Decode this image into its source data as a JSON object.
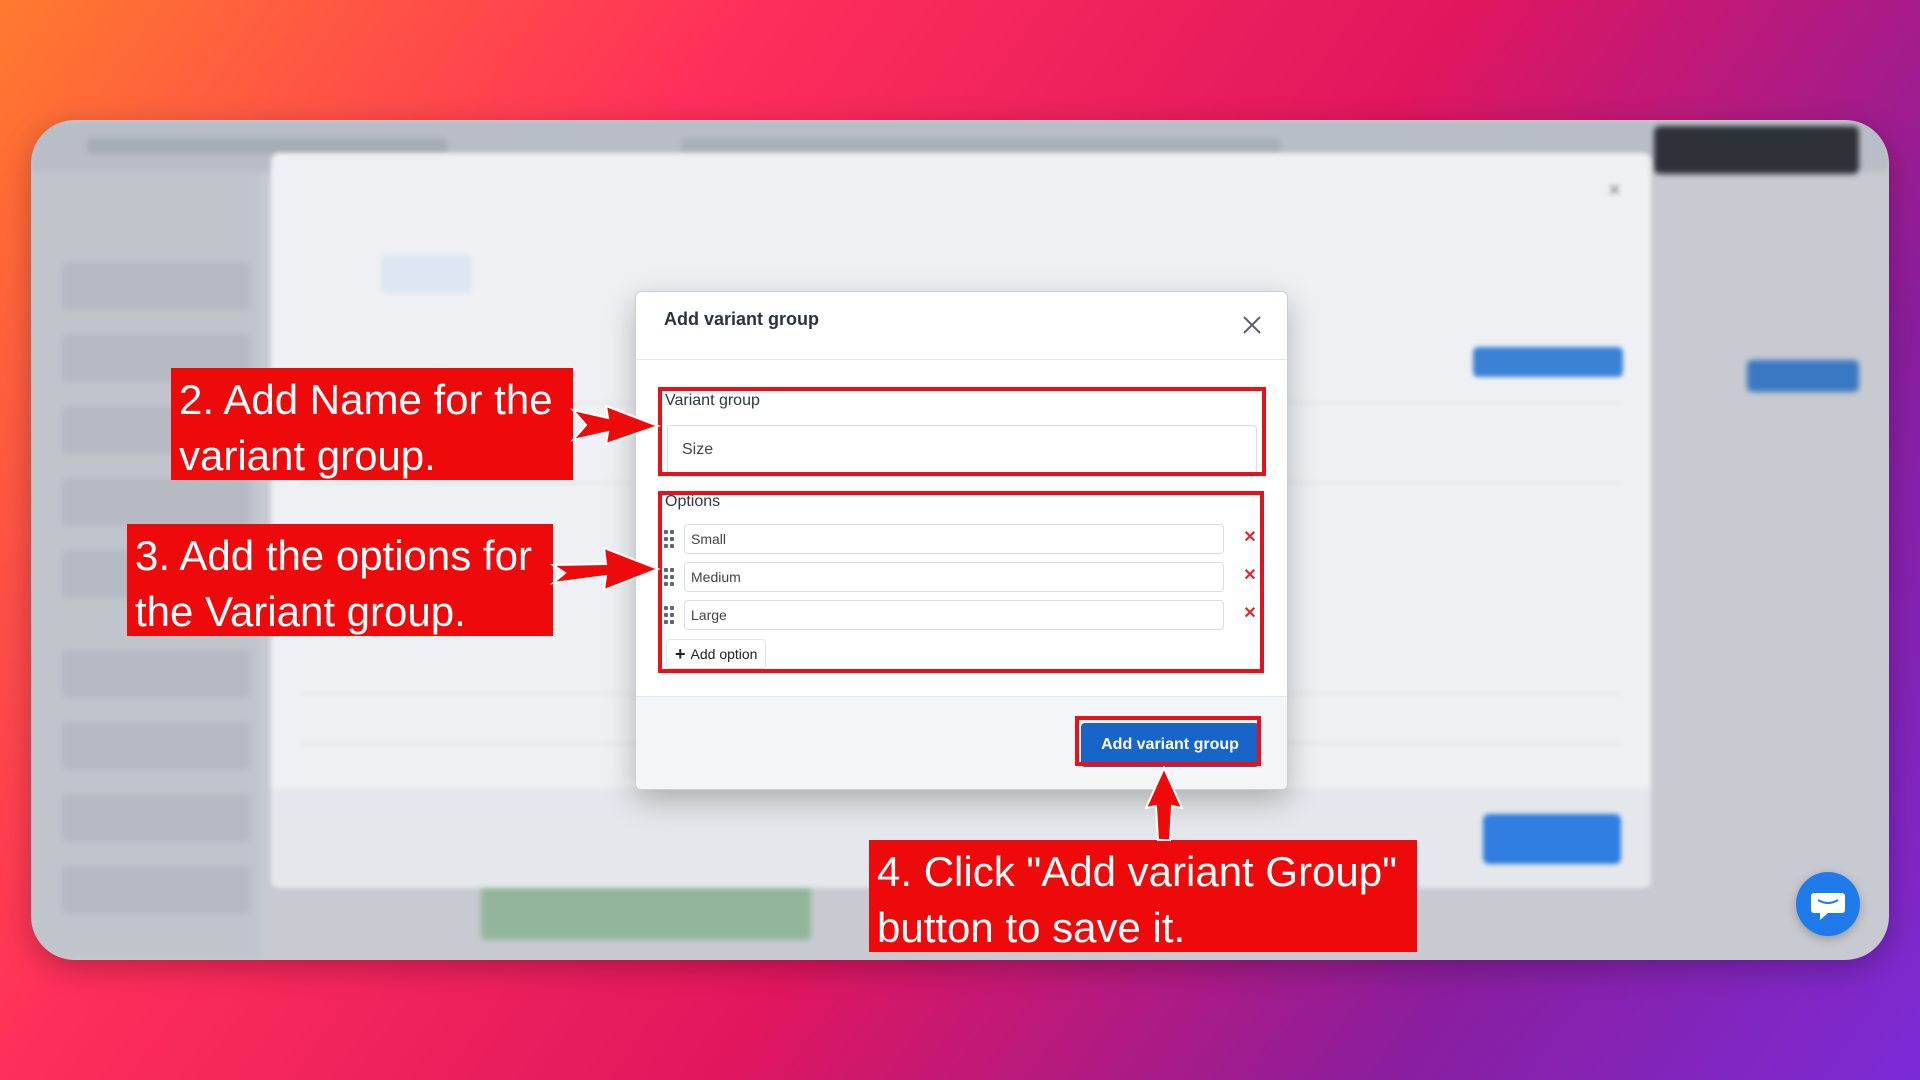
{
  "dialog": {
    "title": "Add variant group",
    "close_icon": "close-icon",
    "variant_group_label": "Variant group",
    "variant_group_value": "Size",
    "options_label": "Options",
    "options": [
      {
        "value": "Small"
      },
      {
        "value": "Medium"
      },
      {
        "value": "Large"
      }
    ],
    "add_option_label": "Add option",
    "submit_label": "Add variant group"
  },
  "callouts": {
    "step2": [
      "2. Add Name for the",
      "variant group."
    ],
    "step3": [
      "3. Add the options for",
      "the Variant group."
    ],
    "step4": [
      "4. Click \"Add variant Group\"",
      "button to save it."
    ]
  },
  "colors": {
    "annotation_red": "#ee0a0a",
    "primary_button": "#1765c9",
    "delete_red": "#e5252a"
  }
}
